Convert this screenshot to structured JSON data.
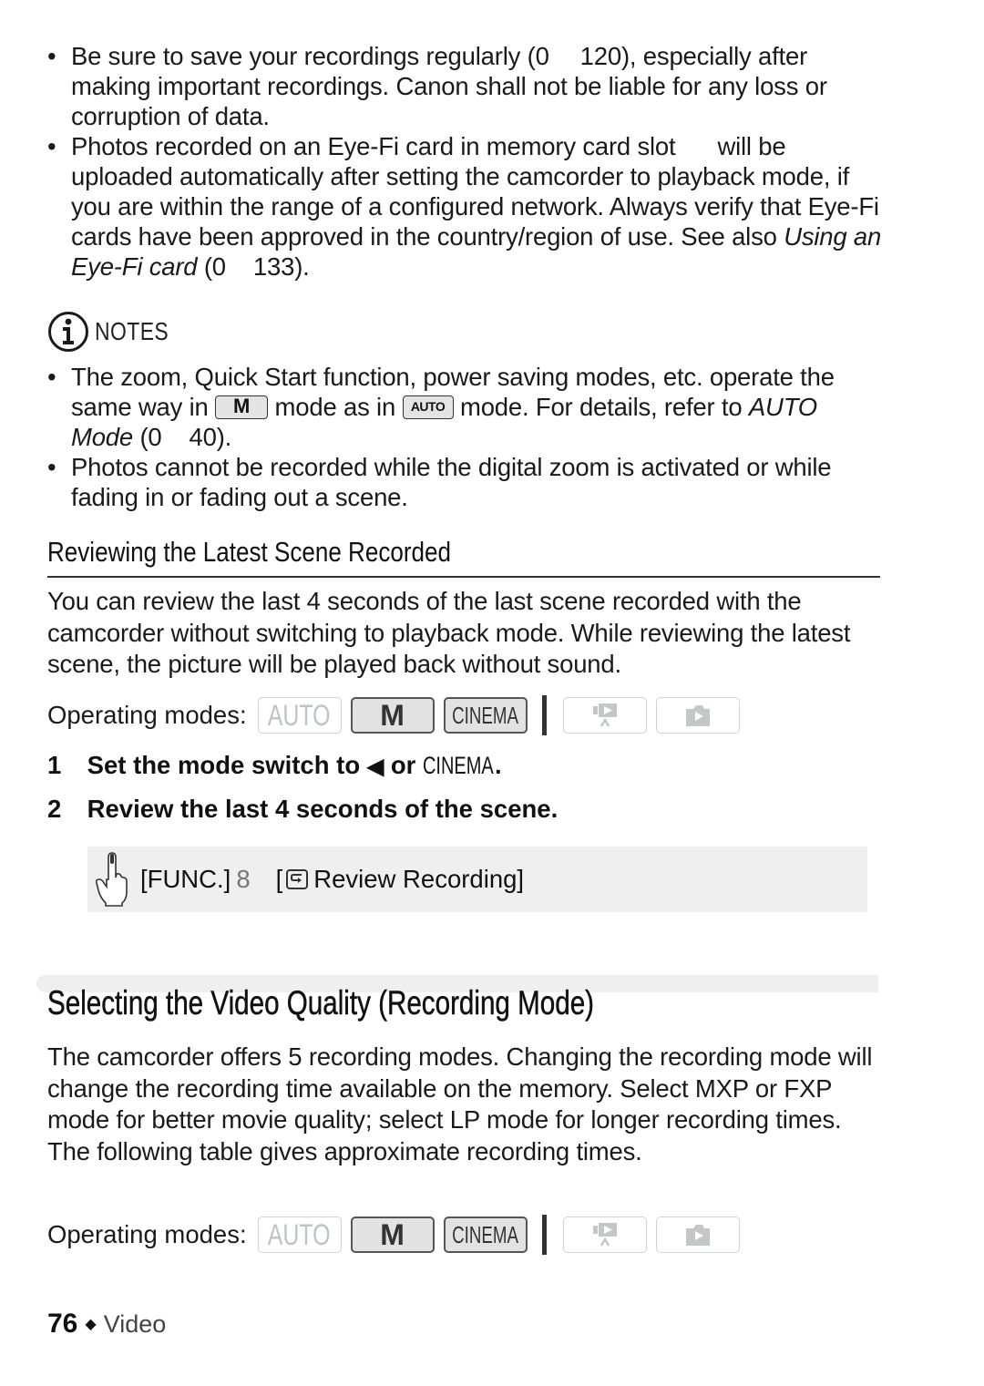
{
  "top_bullets": [
    {
      "part1": "Be sure to save your recordings regularly (",
      "ref_symbol": "0",
      "ref_page": "120",
      "part2": "), especially after making important recordings. Canon shall not be liable for any loss or corruption of data."
    },
    {
      "part1": "Photos recorded on an Eye-Fi card in memory card slot",
      "part2": "will be uploaded automatically after setting the camcorder to playback mode, if you are within the range of a configured network. Always verify that Eye-Fi cards have been approved in the country/region of use. See also",
      "link_text": "Using an Eye-Fi card",
      "ref_symbol": "0",
      "ref_page": "133",
      "suffix": ")."
    }
  ],
  "notes": {
    "icon": "info-icon",
    "title": "NOTES",
    "items": [
      {
        "part1": "The zoom, Quick Start function, power saving modes, etc. operate the same way in",
        "key1": "M",
        "part2": "mode as in",
        "key2": "AUTO",
        "part3": "mode. For details, refer to",
        "link_text": "AUTO Mode",
        "ref_symbol": "0",
        "ref_page": "40",
        "suffix": ")."
      },
      {
        "text": "Photos cannot be recorded while the digital zoom is activated or while fading in or fading out a scene."
      }
    ]
  },
  "review_section": {
    "heading": "Reviewing the Latest Scene Recorded",
    "paragraph": "You can review the last 4 seconds of the last scene recorded with the camcorder without switching to playback mode. While reviewing the latest scene, the picture will be played back without sound.",
    "operating_modes": {
      "label": "Operating modes:",
      "modes": [
        {
          "label": "AUTO",
          "state": "inactive"
        },
        {
          "label": "M",
          "state": "active"
        },
        {
          "label": "CINEMA",
          "state": "active"
        },
        {
          "icon": "movie-playback-icon",
          "state": "inactive"
        },
        {
          "icon": "photo-playback-icon",
          "state": "inactive"
        }
      ]
    },
    "steps": [
      {
        "num": "1",
        "text_before": "Set the mode switch to",
        "symbol": "◀",
        "text_mid": "or",
        "mode": "CINEMA",
        "text_after": "."
      },
      {
        "num": "2",
        "text": "Review the last 4 seconds of the scene."
      }
    ],
    "func_instruction": {
      "icon": "touch-hand-icon",
      "func": "[FUNC.]",
      "arrow": "8",
      "bracket_open": "[",
      "item_icon": "review-recording-icon",
      "item_label": "Review Recording]"
    }
  },
  "quality_section": {
    "title": "Selecting the Video Quality (Recording Mode)",
    "paragraph": "The camcorder offers 5 recording modes. Changing the recording mode will change the recording time available on the memory. Select MXP or FXP mode for better movie quality; select LP mode for longer recording times. The following table gives approximate recording times.",
    "operating_modes": {
      "label": "Operating modes:",
      "modes": [
        {
          "label": "AUTO",
          "state": "inactive"
        },
        {
          "label": "M",
          "state": "active"
        },
        {
          "label": "CINEMA",
          "state": "active"
        },
        {
          "icon": "movie-playback-icon",
          "state": "inactive"
        },
        {
          "icon": "photo-playback-icon",
          "state": "inactive"
        }
      ]
    }
  },
  "footer": {
    "page_number": "76",
    "separator": "◆",
    "section": "Video"
  }
}
